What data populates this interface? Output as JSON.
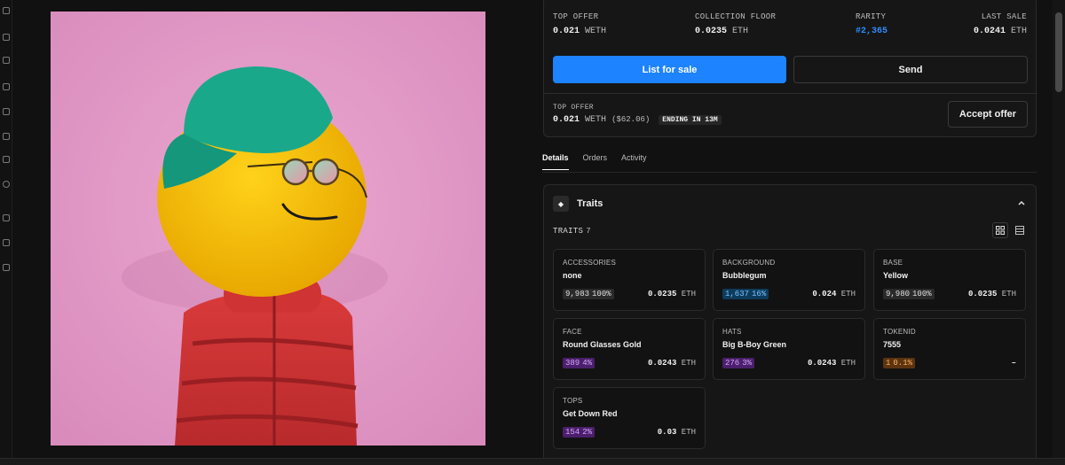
{
  "stats": {
    "top_offer": {
      "label": "TOP OFFER",
      "value": "0.021",
      "unit": "WETH"
    },
    "collection_floor": {
      "label": "COLLECTION FLOOR",
      "value": "0.0235",
      "unit": "ETH"
    },
    "rarity": {
      "label": "RARITY",
      "value": "#2,365"
    },
    "last_sale": {
      "label": "LAST SALE",
      "value": "0.0241",
      "unit": "ETH"
    }
  },
  "actions": {
    "list_for_sale": "List for sale",
    "send": "Send",
    "accept_offer": "Accept offer"
  },
  "offer": {
    "label": "TOP OFFER",
    "value": "0.021",
    "unit": "WETH",
    "usd": "($62.06)",
    "ending": "ENDING IN 13M"
  },
  "tabs": [
    "Details",
    "Orders",
    "Activity"
  ],
  "traits": {
    "title": "Traits",
    "count_label": "TRAITS",
    "count": "7",
    "items": [
      {
        "type": "ACCESSORIES",
        "value": "none",
        "count": "9,983",
        "pct": "100%",
        "price": "0.0235",
        "unit": "ETH",
        "badge_color": "#2a2a2a",
        "badge_text": "#e0e0e0"
      },
      {
        "type": "BACKGROUND",
        "value": "Bubblegum",
        "count": "1,637",
        "pct": "16%",
        "price": "0.024",
        "unit": "ETH",
        "badge_color": "#0d3b5c",
        "badge_text": "#7fc4ff"
      },
      {
        "type": "BASE",
        "value": "Yellow",
        "count": "9,980",
        "pct": "100%",
        "price": "0.0235",
        "unit": "ETH",
        "badge_color": "#2a2a2a",
        "badge_text": "#e0e0e0"
      },
      {
        "type": "FACE",
        "value": "Round Glasses Gold",
        "count": "389",
        "pct": "4%",
        "price": "0.0243",
        "unit": "ETH",
        "badge_color": "#4b1f6b",
        "badge_text": "#d6a8ff"
      },
      {
        "type": "HATS",
        "value": "Big B-Boy Green",
        "count": "276",
        "pct": "3%",
        "price": "0.0243",
        "unit": "ETH",
        "badge_color": "#4b1f6b",
        "badge_text": "#d6a8ff"
      },
      {
        "type": "TOKENID",
        "value": "7555",
        "count": "1",
        "pct": "0.1%",
        "price": "–",
        "unit": "",
        "badge_color": "#5c3410",
        "badge_text": "#ffb060"
      },
      {
        "type": "TOPS",
        "value": "Get Down Red",
        "count": "154",
        "pct": "2%",
        "price": "0.03",
        "unit": "ETH",
        "badge_color": "#4b1f6b",
        "badge_text": "#d6a8ff"
      }
    ]
  },
  "colors": {
    "accent": "#1d83ff",
    "rarity": "#2f8cff",
    "background": "#111111",
    "card": "#161616"
  }
}
